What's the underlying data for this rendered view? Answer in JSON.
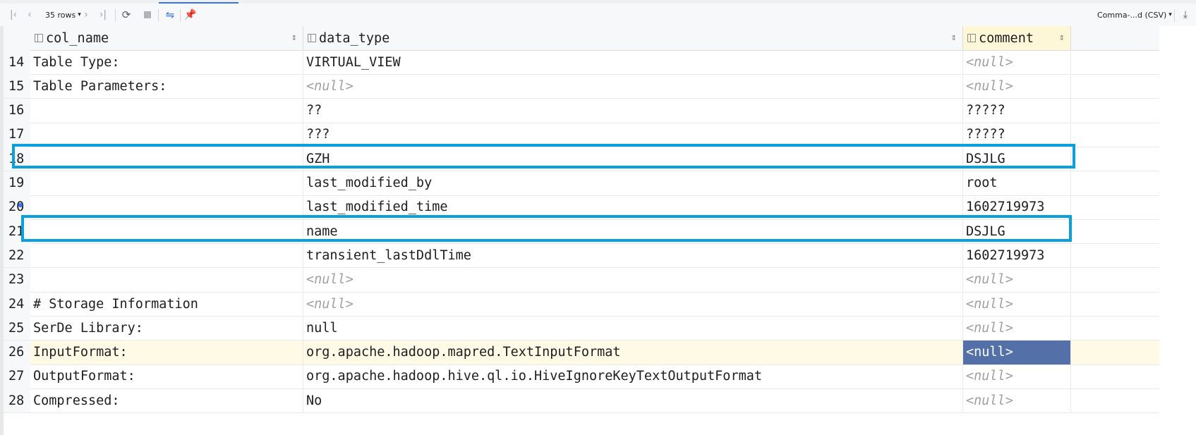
{
  "toolbar": {
    "rows_label": "35 rows",
    "export_format": "Comma-...d (CSV)"
  },
  "columns": [
    "col_name",
    "data_type",
    "comment"
  ],
  "rows": [
    {
      "num": "14",
      "col_name": "Table Type:",
      "data_type": "VIRTUAL_VIEW",
      "comment": "<null>"
    },
    {
      "num": "15",
      "col_name": "Table Parameters:",
      "data_type": "<null>",
      "comment": "<null>"
    },
    {
      "num": "16",
      "col_name": "",
      "data_type": "??",
      "comment": "?????"
    },
    {
      "num": "17",
      "col_name": "",
      "data_type": "???",
      "comment": "?????"
    },
    {
      "num": "18",
      "col_name": "",
      "data_type": "GZH",
      "comment": "DSJLG"
    },
    {
      "num": "19",
      "col_name": "",
      "data_type": "last_modified_by",
      "comment": "root"
    },
    {
      "num": "20",
      "col_name": "",
      "data_type": "last_modified_time",
      "comment": "1602719973"
    },
    {
      "num": "21",
      "col_name": "",
      "data_type": "name",
      "comment": "DSJLG"
    },
    {
      "num": "22",
      "col_name": "",
      "data_type": "transient_lastDdlTime",
      "comment": "1602719973"
    },
    {
      "num": "23",
      "col_name": "",
      "data_type": "<null>",
      "comment": "<null>"
    },
    {
      "num": "24",
      "col_name": "# Storage Information",
      "data_type": "<null>",
      "comment": "<null>"
    },
    {
      "num": "25",
      "col_name": "SerDe Library:",
      "data_type": "null",
      "comment": "<null>"
    },
    {
      "num": "26",
      "col_name": "InputFormat:",
      "data_type": "org.apache.hadoop.mapred.TextInputFormat",
      "comment": "<null>"
    },
    {
      "num": "27",
      "col_name": "OutputFormat:",
      "data_type": "org.apache.hadoop.hive.ql.io.HiveIgnoreKeyTextOutputFormat",
      "comment": "<null>"
    },
    {
      "num": "28",
      "col_name": "Compressed:",
      "data_type": "No",
      "comment": "<null>"
    }
  ],
  "selected_row": "26",
  "highlight_color": "#0aa0e0",
  "selected_cell_color": "#5470a8"
}
